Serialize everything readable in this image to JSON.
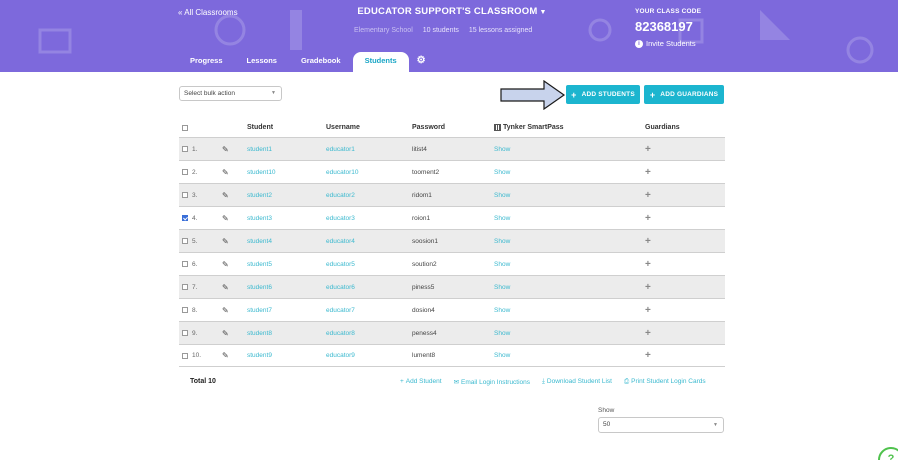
{
  "header": {
    "back_link": "« All Classrooms",
    "class_title": "EDUCATOR SUPPORT'S CLASSROOM",
    "school": "Elementary School",
    "students_count": "10 students",
    "lessons_count": "15 lessons assigned",
    "code_label": "YOUR CLASS CODE",
    "code_value": "82368197",
    "invite_label": "Invite Students",
    "background_color": "#7d69dc"
  },
  "tabs": [
    {
      "label": "Progress",
      "active": false
    },
    {
      "label": "Lessons",
      "active": false
    },
    {
      "label": "Gradebook",
      "active": false
    },
    {
      "label": "Students",
      "active": true
    }
  ],
  "toolbar": {
    "bulk_action_placeholder": "Select bulk action",
    "add_students_label": "ADD STUDENTS",
    "add_guardians_label": "ADD GUARDIANS",
    "accent_color": "#1cb5cf"
  },
  "table": {
    "headers": {
      "student": "Student",
      "username": "Username",
      "password": "Password",
      "smartpass": "Tynker SmartPass",
      "guardians": "Guardians"
    },
    "rows": [
      {
        "num": "1.",
        "student": "student1",
        "username": "educator1",
        "password": "litist4",
        "smartpass": "Show",
        "checked": false
      },
      {
        "num": "2.",
        "student": "student10",
        "username": "educator10",
        "password": "tooment2",
        "smartpass": "Show",
        "checked": false
      },
      {
        "num": "3.",
        "student": "student2",
        "username": "educator2",
        "password": "ridom1",
        "smartpass": "Show",
        "checked": false
      },
      {
        "num": "4.",
        "student": "student3",
        "username": "educator3",
        "password": "roion1",
        "smartpass": "Show",
        "checked": true
      },
      {
        "num": "5.",
        "student": "student4",
        "username": "educator4",
        "password": "soosion1",
        "smartpass": "Show",
        "checked": false
      },
      {
        "num": "6.",
        "student": "student5",
        "username": "educator5",
        "password": "soution2",
        "smartpass": "Show",
        "checked": false
      },
      {
        "num": "7.",
        "student": "student6",
        "username": "educator6",
        "password": "piness5",
        "smartpass": "Show",
        "checked": false
      },
      {
        "num": "8.",
        "student": "student7",
        "username": "educator7",
        "password": "dosion4",
        "smartpass": "Show",
        "checked": false
      },
      {
        "num": "9.",
        "student": "student8",
        "username": "educator8",
        "password": "peness4",
        "smartpass": "Show",
        "checked": false
      },
      {
        "num": "10.",
        "student": "student9",
        "username": "educator9",
        "password": "lument8",
        "smartpass": "Show",
        "checked": false
      }
    ]
  },
  "footer": {
    "total": "Total 10",
    "add_student": "Add Student",
    "email_login": "Email Login Instructions",
    "download_list": "Download Student List",
    "print_cards": "Print Student Login Cards",
    "show_label": "Show",
    "show_value": "50"
  }
}
